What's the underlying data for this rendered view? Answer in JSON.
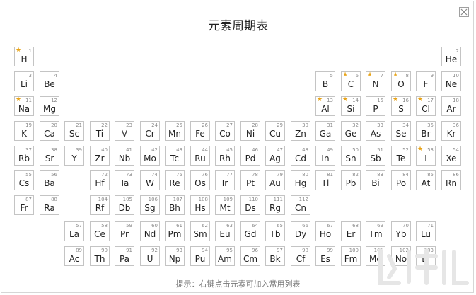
{
  "dialog": {
    "title": "元素周期表",
    "hint": "提示：右键点击元素可加入常用列表"
  },
  "colors": {
    "star": "#e8a317",
    "border": "#c4c4c4"
  },
  "icons": {
    "close": "close-icon",
    "favorite": "star-icon"
  },
  "elements": [
    {
      "n": "1",
      "s": "H",
      "c": 1,
      "r": 1,
      "fav": true
    },
    {
      "n": "2",
      "s": "He",
      "c": 18,
      "r": 1
    },
    {
      "n": "3",
      "s": "Li",
      "c": 1,
      "r": 2
    },
    {
      "n": "4",
      "s": "Be",
      "c": 2,
      "r": 2
    },
    {
      "n": "5",
      "s": "B",
      "c": 13,
      "r": 2
    },
    {
      "n": "6",
      "s": "C",
      "c": 14,
      "r": 2,
      "fav": true
    },
    {
      "n": "7",
      "s": "N",
      "c": 15,
      "r": 2,
      "fav": true
    },
    {
      "n": "8",
      "s": "O",
      "c": 16,
      "r": 2,
      "fav": true
    },
    {
      "n": "9",
      "s": "F",
      "c": 17,
      "r": 2
    },
    {
      "n": "10",
      "s": "Ne",
      "c": 18,
      "r": 2
    },
    {
      "n": "11",
      "s": "Na",
      "c": 1,
      "r": 3,
      "fav": true
    },
    {
      "n": "12",
      "s": "Mg",
      "c": 2,
      "r": 3
    },
    {
      "n": "13",
      "s": "Al",
      "c": 13,
      "r": 3,
      "fav": true
    },
    {
      "n": "14",
      "s": "Si",
      "c": 14,
      "r": 3,
      "fav": true
    },
    {
      "n": "15",
      "s": "P",
      "c": 15,
      "r": 3
    },
    {
      "n": "16",
      "s": "S",
      "c": 16,
      "r": 3,
      "fav": true
    },
    {
      "n": "17",
      "s": "Cl",
      "c": 17,
      "r": 3,
      "fav": true
    },
    {
      "n": "18",
      "s": "Ar",
      "c": 18,
      "r": 3
    },
    {
      "n": "19",
      "s": "K",
      "c": 1,
      "r": 4
    },
    {
      "n": "20",
      "s": "Ca",
      "c": 2,
      "r": 4
    },
    {
      "n": "21",
      "s": "Sc",
      "c": 3,
      "r": 4
    },
    {
      "n": "22",
      "s": "Ti",
      "c": 4,
      "r": 4
    },
    {
      "n": "23",
      "s": "V",
      "c": 5,
      "r": 4
    },
    {
      "n": "24",
      "s": "Cr",
      "c": 6,
      "r": 4
    },
    {
      "n": "25",
      "s": "Mn",
      "c": 7,
      "r": 4
    },
    {
      "n": "26",
      "s": "Fe",
      "c": 8,
      "r": 4
    },
    {
      "n": "27",
      "s": "Co",
      "c": 9,
      "r": 4
    },
    {
      "n": "28",
      "s": "Ni",
      "c": 10,
      "r": 4
    },
    {
      "n": "29",
      "s": "Cu",
      "c": 11,
      "r": 4
    },
    {
      "n": "30",
      "s": "Zn",
      "c": 12,
      "r": 4
    },
    {
      "n": "31",
      "s": "Ga",
      "c": 13,
      "r": 4
    },
    {
      "n": "32",
      "s": "Ge",
      "c": 14,
      "r": 4
    },
    {
      "n": "33",
      "s": "As",
      "c": 15,
      "r": 4
    },
    {
      "n": "34",
      "s": "Se",
      "c": 16,
      "r": 4
    },
    {
      "n": "35",
      "s": "Br",
      "c": 17,
      "r": 4
    },
    {
      "n": "36",
      "s": "Kr",
      "c": 18,
      "r": 4
    },
    {
      "n": "37",
      "s": "Rb",
      "c": 1,
      "r": 5
    },
    {
      "n": "38",
      "s": "Sr",
      "c": 2,
      "r": 5
    },
    {
      "n": "39",
      "s": "Y",
      "c": 3,
      "r": 5
    },
    {
      "n": "40",
      "s": "Zr",
      "c": 4,
      "r": 5
    },
    {
      "n": "41",
      "s": "Nb",
      "c": 5,
      "r": 5
    },
    {
      "n": "42",
      "s": "Mo",
      "c": 6,
      "r": 5
    },
    {
      "n": "43",
      "s": "Tc",
      "c": 7,
      "r": 5
    },
    {
      "n": "44",
      "s": "Ru",
      "c": 8,
      "r": 5
    },
    {
      "n": "45",
      "s": "Rh",
      "c": 9,
      "r": 5
    },
    {
      "n": "46",
      "s": "Pd",
      "c": 10,
      "r": 5
    },
    {
      "n": "47",
      "s": "Ag",
      "c": 11,
      "r": 5
    },
    {
      "n": "48",
      "s": "Cd",
      "c": 12,
      "r": 5
    },
    {
      "n": "49",
      "s": "In",
      "c": 13,
      "r": 5
    },
    {
      "n": "50",
      "s": "Sn",
      "c": 14,
      "r": 5
    },
    {
      "n": "51",
      "s": "Sb",
      "c": 15,
      "r": 5
    },
    {
      "n": "52",
      "s": "Te",
      "c": 16,
      "r": 5
    },
    {
      "n": "53",
      "s": "I",
      "c": 17,
      "r": 5,
      "fav": true
    },
    {
      "n": "54",
      "s": "Xe",
      "c": 18,
      "r": 5
    },
    {
      "n": "55",
      "s": "Cs",
      "c": 1,
      "r": 6
    },
    {
      "n": "56",
      "s": "Ba",
      "c": 2,
      "r": 6
    },
    {
      "n": "72",
      "s": "Hf",
      "c": 4,
      "r": 6
    },
    {
      "n": "73",
      "s": "Ta",
      "c": 5,
      "r": 6
    },
    {
      "n": "74",
      "s": "W",
      "c": 6,
      "r": 6
    },
    {
      "n": "75",
      "s": "Re",
      "c": 7,
      "r": 6
    },
    {
      "n": "76",
      "s": "Os",
      "c": 8,
      "r": 6
    },
    {
      "n": "77",
      "s": "Ir",
      "c": 9,
      "r": 6
    },
    {
      "n": "78",
      "s": "Pt",
      "c": 10,
      "r": 6
    },
    {
      "n": "79",
      "s": "Au",
      "c": 11,
      "r": 6
    },
    {
      "n": "80",
      "s": "Hg",
      "c": 12,
      "r": 6
    },
    {
      "n": "81",
      "s": "Tl",
      "c": 13,
      "r": 6
    },
    {
      "n": "82",
      "s": "Pb",
      "c": 14,
      "r": 6
    },
    {
      "n": "83",
      "s": "Bi",
      "c": 15,
      "r": 6
    },
    {
      "n": "84",
      "s": "Po",
      "c": 16,
      "r": 6
    },
    {
      "n": "85",
      "s": "At",
      "c": 17,
      "r": 6
    },
    {
      "n": "86",
      "s": "Rn",
      "c": 18,
      "r": 6
    },
    {
      "n": "87",
      "s": "Fr",
      "c": 1,
      "r": 7
    },
    {
      "n": "88",
      "s": "Ra",
      "c": 2,
      "r": 7
    },
    {
      "n": "104",
      "s": "Rf",
      "c": 4,
      "r": 7
    },
    {
      "n": "105",
      "s": "Db",
      "c": 5,
      "r": 7
    },
    {
      "n": "106",
      "s": "Sg",
      "c": 6,
      "r": 7
    },
    {
      "n": "107",
      "s": "Bh",
      "c": 7,
      "r": 7
    },
    {
      "n": "108",
      "s": "Hs",
      "c": 8,
      "r": 7
    },
    {
      "n": "109",
      "s": "Mt",
      "c": 9,
      "r": 7
    },
    {
      "n": "110",
      "s": "Ds",
      "c": 10,
      "r": 7
    },
    {
      "n": "111",
      "s": "Rg",
      "c": 11,
      "r": 7
    },
    {
      "n": "112",
      "s": "Cn",
      "c": 12,
      "r": 7
    },
    {
      "n": "57",
      "s": "La",
      "c": 3,
      "r": 8
    },
    {
      "n": "58",
      "s": "Ce",
      "c": 4,
      "r": 8
    },
    {
      "n": "59",
      "s": "Pr",
      "c": 5,
      "r": 8
    },
    {
      "n": "60",
      "s": "Nd",
      "c": 6,
      "r": 8
    },
    {
      "n": "61",
      "s": "Pm",
      "c": 7,
      "r": 8
    },
    {
      "n": "62",
      "s": "Sm",
      "c": 8,
      "r": 8
    },
    {
      "n": "63",
      "s": "Eu",
      "c": 9,
      "r": 8
    },
    {
      "n": "64",
      "s": "Gd",
      "c": 10,
      "r": 8
    },
    {
      "n": "65",
      "s": "Tb",
      "c": 11,
      "r": 8
    },
    {
      "n": "66",
      "s": "Dy",
      "c": 12,
      "r": 8
    },
    {
      "n": "67",
      "s": "Ho",
      "c": 13,
      "r": 8
    },
    {
      "n": "68",
      "s": "Er",
      "c": 14,
      "r": 8
    },
    {
      "n": "69",
      "s": "Tm",
      "c": 15,
      "r": 8
    },
    {
      "n": "70",
      "s": "Yb",
      "c": 16,
      "r": 8
    },
    {
      "n": "71",
      "s": "Lu",
      "c": 17,
      "r": 8
    },
    {
      "n": "89",
      "s": "Ac",
      "c": 3,
      "r": 9
    },
    {
      "n": "90",
      "s": "Th",
      "c": 4,
      "r": 9
    },
    {
      "n": "91",
      "s": "Pa",
      "c": 5,
      "r": 9
    },
    {
      "n": "92",
      "s": "U",
      "c": 6,
      "r": 9
    },
    {
      "n": "93",
      "s": "Np",
      "c": 7,
      "r": 9
    },
    {
      "n": "94",
      "s": "Pu",
      "c": 8,
      "r": 9
    },
    {
      "n": "95",
      "s": "Am",
      "c": 9,
      "r": 9
    },
    {
      "n": "96",
      "s": "Cm",
      "c": 10,
      "r": 9
    },
    {
      "n": "97",
      "s": "Bk",
      "c": 11,
      "r": 9
    },
    {
      "n": "98",
      "s": "Cf",
      "c": 12,
      "r": 9
    },
    {
      "n": "99",
      "s": "Es",
      "c": 13,
      "r": 9
    },
    {
      "n": "100",
      "s": "Fm",
      "c": 14,
      "r": 9
    },
    {
      "n": "101",
      "s": "Md",
      "c": 15,
      "r": 9
    },
    {
      "n": "102",
      "s": "No",
      "c": 16,
      "r": 9
    },
    {
      "n": "103",
      "s": "Lr",
      "c": 17,
      "r": 9
    }
  ]
}
